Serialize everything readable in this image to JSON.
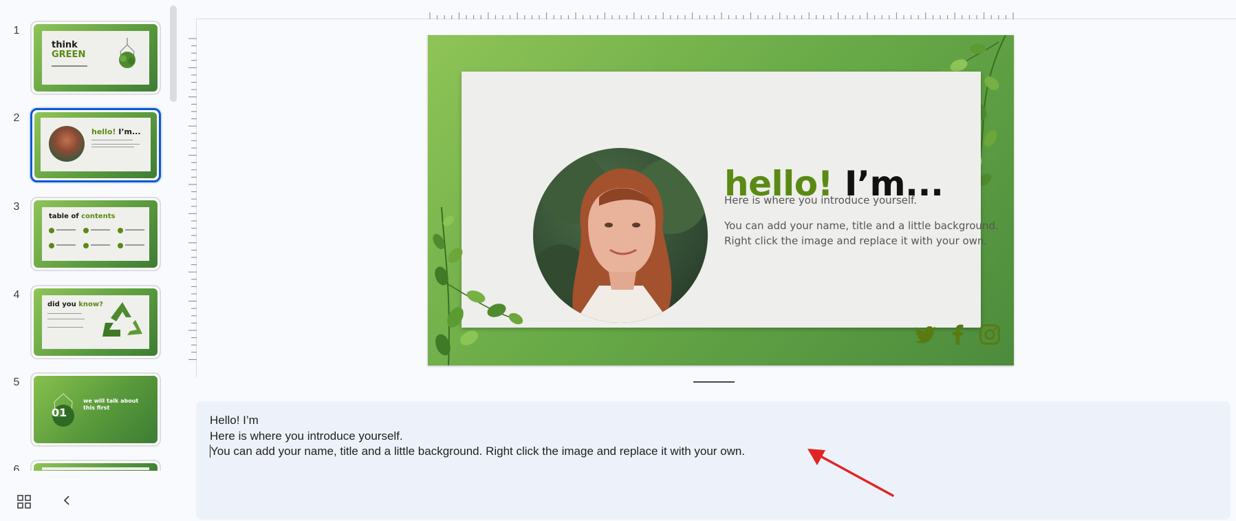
{
  "filmstrip": {
    "slides": [
      {
        "num": "1",
        "title_black": "think",
        "title_green": "GREEN"
      },
      {
        "num": "2",
        "title_green": "hello!",
        "title_black": "I’m..."
      },
      {
        "num": "3",
        "title_black": "table of",
        "title_green": "contents"
      },
      {
        "num": "4",
        "title_black": "did you",
        "title_green": "know?"
      },
      {
        "num": "5",
        "title_black": "01",
        "title_green": "we will talk about this first"
      },
      {
        "num": "6"
      }
    ],
    "selected_index": 1
  },
  "slide": {
    "heading_green": "hello!",
    "heading_black": "I’m...",
    "body_line_1": "Here is where you introduce yourself.",
    "body_line_2": "You can add your name, title and a little background.",
    "body_line_3": "Right click the image and replace it with your own.",
    "social_icons": [
      "twitter-icon",
      "facebook-icon",
      "instagram-icon"
    ],
    "accent_color": "#5a8a13"
  },
  "notes": {
    "line_1": "Hello! I’m",
    "line_2": "Here is where you introduce yourself.",
    "line_3": "You can add your name, title and a little background. Right click the image and replace it with your own."
  },
  "colors": {
    "selection": "#0b57d0",
    "notes_bg": "#edf2fa",
    "arrow": "#e02424"
  }
}
